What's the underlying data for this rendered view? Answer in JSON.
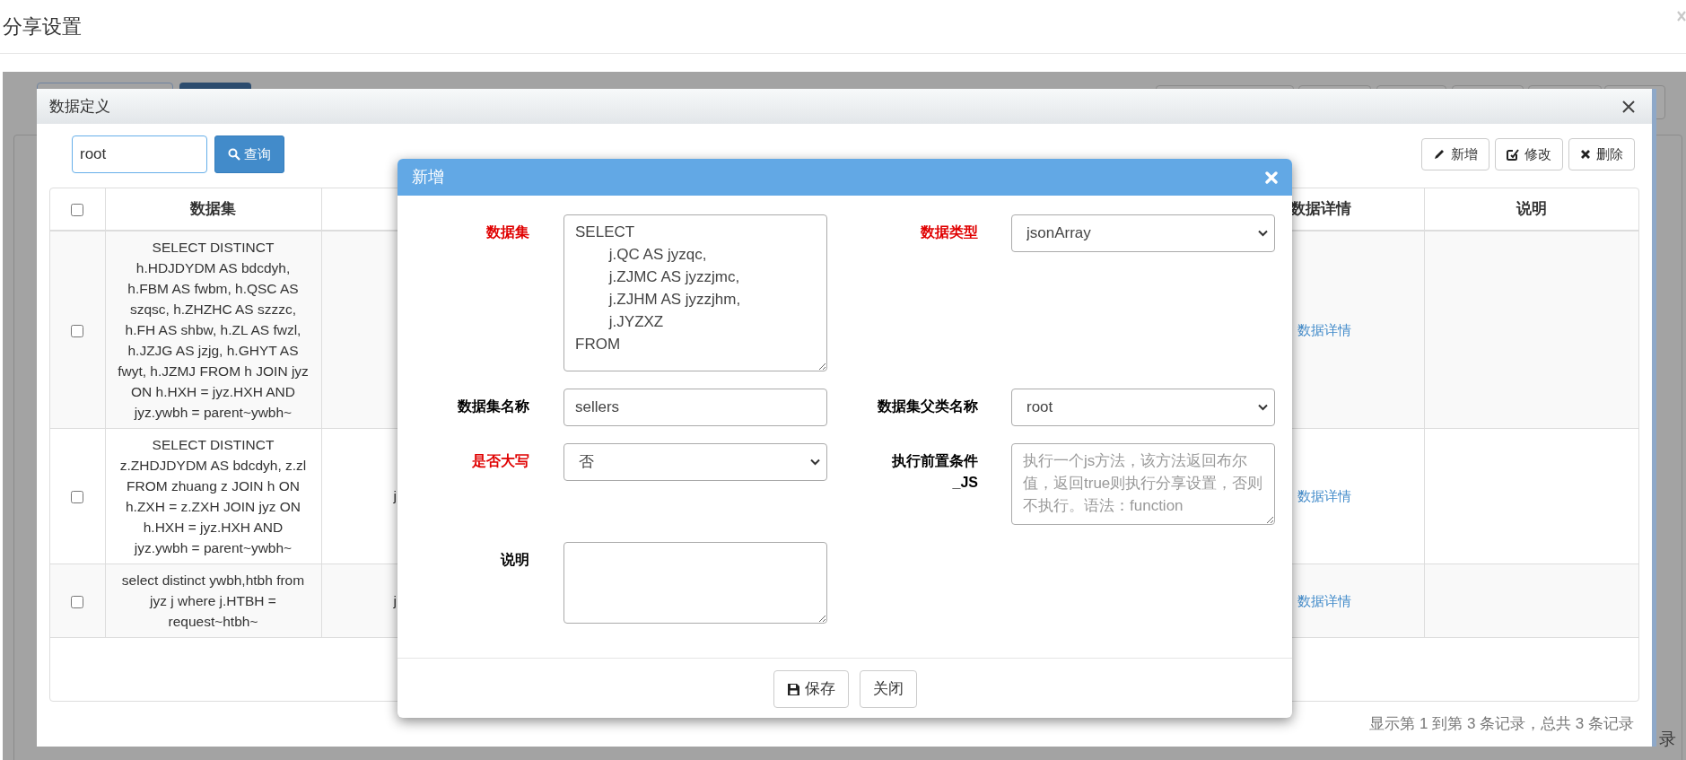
{
  "page": {
    "title": "分享设置"
  },
  "background_texts": [
    {
      "text": "录"
    }
  ],
  "dialog": {
    "title": "数据定义",
    "search": {
      "value": "root"
    },
    "search_button": "查询",
    "toolbar": [
      {
        "kind": "add",
        "label": "新增"
      },
      {
        "kind": "edit",
        "label": "修改"
      },
      {
        "kind": "delete",
        "label": "删除"
      }
    ],
    "table": {
      "select_all_checked": false,
      "columns": [
        "数据集",
        "数据详情",
        "说明"
      ],
      "rows": [
        {
          "checked": false,
          "dataset": "SELECT DISTINCT h.HDJDYDM AS bdcdyh, h.FBM AS fwbm, h.QSC AS szqsc, h.ZHZHC AS szzzc, h.FH AS shbw, h.ZL AS fwzl, h.JZJG AS jzjg, h.GHYT AS fwyt, h.JZMJ FROM h JOIN jyz ON h.HXH = jyz.HXH AND jyz.ywbh = parent~ywbh~",
          "detail_link": "数据详情"
        },
        {
          "checked": false,
          "dataset": "SELECT DISTINCT z.ZHDJDYDM AS bdcdyh, z.zl FROM zhuang z JOIN h ON h.ZXH = z.ZXH JOIN jyz ON h.HXH = jyz.HXH AND jyz.ywbh = parent~ywbh~",
          "column_3": "j",
          "detail_link": "数据详情"
        },
        {
          "checked": false,
          "dataset": "select distinct ywbh,htbh from jyz j where j.HTBH = request~htbh~",
          "column_3": "j",
          "detail_link": "数据详情"
        }
      ]
    },
    "footer": "显示第 1 到第 3 条记录，总共 3 条记录"
  },
  "modal": {
    "title": "新增",
    "fields": [
      {
        "kind": "textarea",
        "label": "数据集",
        "required": true,
        "value": "SELECT\n\tj.QC AS jyzqc,\n\tj.ZJMC AS jyzzjmc,\n\tj.ZJHM AS jyzzjhm,\n\tj.JYZXZ\nFROM"
      },
      {
        "kind": "select",
        "label": "数据类型",
        "required": true,
        "value": "jsonArray"
      },
      {
        "kind": "input",
        "label": "数据集名称",
        "required": false,
        "value": "sellers"
      },
      {
        "kind": "select",
        "label": "数据集父类名称",
        "required": false,
        "value": "root"
      },
      {
        "kind": "select",
        "label": "是否大写",
        "required": true,
        "value": "否"
      },
      {
        "kind": "textarea",
        "label": "执行前置条件_JS",
        "required": false,
        "placeholder": "执行一个js方法，该方法返回布尔值，返回true则执行分享设置，否则不执行。语法：function"
      },
      {
        "kind": "textarea",
        "label": "说明",
        "required": false
      }
    ],
    "buttons": [
      {
        "kind": "save",
        "label": "保存"
      },
      {
        "kind": "close",
        "label": "关闭"
      }
    ]
  }
}
